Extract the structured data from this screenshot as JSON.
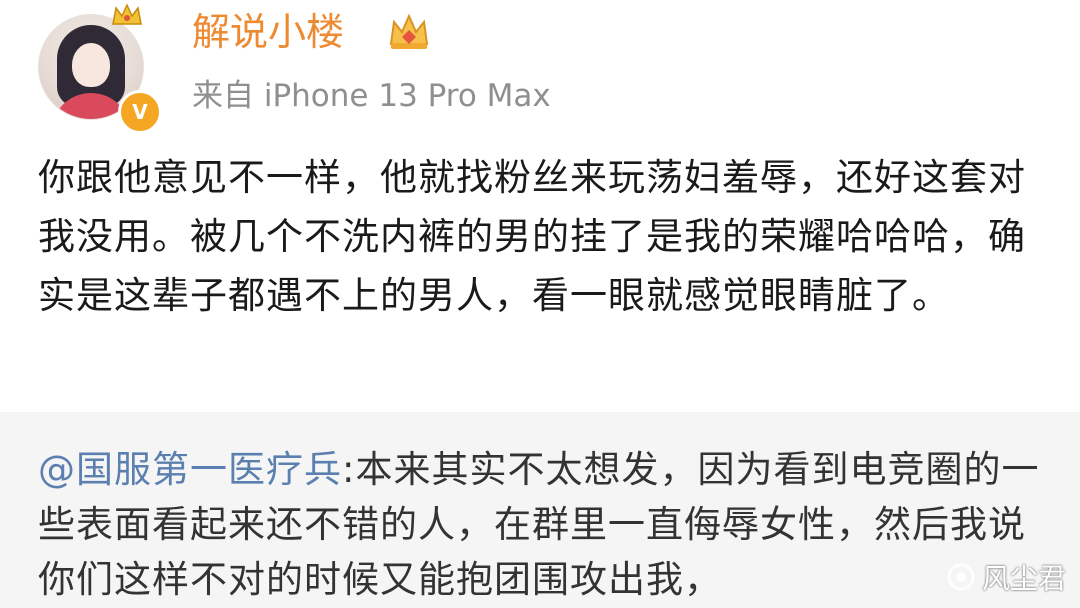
{
  "header": {
    "username": "解说小楼",
    "source": "来自 iPhone 13 Pro Max",
    "verify_badge": "V",
    "vip_icon": "crown-icon",
    "colors": {
      "username": "#ee8a32",
      "verify_badge": "#f5a623"
    }
  },
  "post": {
    "text": "你跟他意见不一样，他就找粉丝来玩荡妇羞辱，还好这套对我没用。被几个不洗内裤的男的挂了是我的荣耀哈哈哈，确实是这辈子都遇不上的男人，看一眼就感觉眼睛脏了。"
  },
  "repost": {
    "mention": "@国服第一医疗兵",
    "text": ":本来其实不太想发，因为看到电竞圈的一些表面看起来还不错的人，在群里一直侮辱女性，然后我说你们这样不对的时候又能抱团围攻出我，",
    "colors": {
      "mention": "#5b7faf",
      "background": "#f5f5f5"
    }
  },
  "watermark": {
    "text": "风尘君"
  }
}
